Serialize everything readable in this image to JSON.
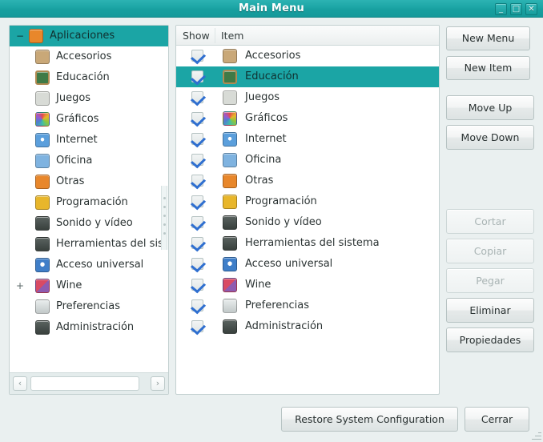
{
  "window": {
    "title": "Main Menu",
    "controls": {
      "minimize": {
        "name": "minimize-button",
        "glyph": "_"
      },
      "maximize": {
        "name": "maximize-button",
        "glyph": "□"
      },
      "close": {
        "name": "close-button",
        "glyph": "✕"
      }
    },
    "accent_color": "#1ba5a5",
    "titlebar_color": "#1ba4a4",
    "background_color": "#eaf0f0"
  },
  "tree": {
    "root": {
      "label": "Aplicaciones",
      "expander": "−",
      "selected": true,
      "icon": "applications-icon",
      "icon_color": "#e8872b"
    },
    "items": [
      {
        "label": "Accesorios",
        "icon": "accessories-icon",
        "icon_color": "#c9a878",
        "expander": ""
      },
      {
        "label": "Educación",
        "icon": "education-icon",
        "icon_color": "#3f7a46",
        "expander": ""
      },
      {
        "label": "Juegos",
        "icon": "games-icon",
        "icon_color": "#d8dbd6",
        "expander": ""
      },
      {
        "label": "Gráficos",
        "icon": "graphics-icon",
        "icon_color": "#c8d43a",
        "expander": ""
      },
      {
        "label": "Internet",
        "icon": "internet-icon",
        "icon_color": "#5b9fdc",
        "expander": ""
      },
      {
        "label": "Oficina",
        "icon": "office-icon",
        "icon_color": "#7fb3e0",
        "expander": ""
      },
      {
        "label": "Otras",
        "icon": "other-icon",
        "icon_color": "#e8872b",
        "expander": ""
      },
      {
        "label": "Programación",
        "icon": "programming-icon",
        "icon_color": "#e8b62b",
        "expander": ""
      },
      {
        "label": "Sonido y vídeo",
        "icon": "sound-video-icon",
        "icon_color": "#3a4a42",
        "expander": ""
      },
      {
        "label": "Herramientas del sist",
        "icon": "system-tools-icon",
        "icon_color": "#4a5350",
        "expander": ""
      },
      {
        "label": "Acceso universal",
        "icon": "universal-access-icon",
        "icon_color": "#3f7ec8",
        "expander": ""
      },
      {
        "label": "Wine",
        "icon": "wine-icon",
        "icon_color": "#c83a52",
        "expander": "+"
      },
      {
        "label": "Preferencias",
        "icon": "preferences-icon",
        "icon_color": "#c9cfcf",
        "expander": ""
      },
      {
        "label": "Administración",
        "icon": "administration-icon",
        "icon_color": "#4a5350",
        "expander": ""
      }
    ],
    "hscroll": {
      "left_arrow": "‹",
      "right_arrow": "›"
    }
  },
  "list": {
    "columns": [
      "Show",
      "Item"
    ],
    "rows": [
      {
        "label": "Accesorios",
        "checked": true,
        "selected": false,
        "icon": "accessories-icon",
        "icon_color": "#c9a878"
      },
      {
        "label": "Educación",
        "checked": true,
        "selected": true,
        "icon": "education-icon",
        "icon_color": "#3f7a46"
      },
      {
        "label": "Juegos",
        "checked": true,
        "selected": false,
        "icon": "games-icon",
        "icon_color": "#d8dbd6"
      },
      {
        "label": "Gráficos",
        "checked": true,
        "selected": false,
        "icon": "graphics-icon",
        "icon_color": "#c8d43a"
      },
      {
        "label": "Internet",
        "checked": true,
        "selected": false,
        "icon": "internet-icon",
        "icon_color": "#5b9fdc"
      },
      {
        "label": "Oficina",
        "checked": true,
        "selected": false,
        "icon": "office-icon",
        "icon_color": "#7fb3e0"
      },
      {
        "label": "Otras",
        "checked": true,
        "selected": false,
        "icon": "other-icon",
        "icon_color": "#e8872b"
      },
      {
        "label": "Programación",
        "checked": true,
        "selected": false,
        "icon": "programming-icon",
        "icon_color": "#e8b62b"
      },
      {
        "label": "Sonido y vídeo",
        "checked": true,
        "selected": false,
        "icon": "sound-video-icon",
        "icon_color": "#3a4a42"
      },
      {
        "label": "Herramientas del sistema",
        "checked": true,
        "selected": false,
        "icon": "system-tools-icon",
        "icon_color": "#4a5350"
      },
      {
        "label": "Acceso universal",
        "checked": true,
        "selected": false,
        "icon": "universal-access-icon",
        "icon_color": "#3f7ec8"
      },
      {
        "label": "Wine",
        "checked": true,
        "selected": false,
        "icon": "wine-icon",
        "icon_color": "#c83a52"
      },
      {
        "label": "Preferencias",
        "checked": true,
        "selected": false,
        "icon": "preferences-icon",
        "icon_color": "#c9cfcf"
      },
      {
        "label": "Administración",
        "checked": true,
        "selected": false,
        "icon": "administration-icon",
        "icon_color": "#4a5350"
      }
    ]
  },
  "side_buttons": [
    {
      "id": "new-menu",
      "label": "New Menu",
      "enabled": true
    },
    {
      "id": "new-item",
      "label": "New Item",
      "enabled": true
    },
    {
      "id": "move-up",
      "label": "Move Up",
      "enabled": true
    },
    {
      "id": "move-down",
      "label": "Move Down",
      "enabled": true
    },
    {
      "id": "cut",
      "label": "Cortar",
      "enabled": false
    },
    {
      "id": "copy",
      "label": "Copiar",
      "enabled": false
    },
    {
      "id": "paste",
      "label": "Pegar",
      "enabled": false
    },
    {
      "id": "delete",
      "label": "Eliminar",
      "enabled": true
    },
    {
      "id": "properties",
      "label": "Propiedades",
      "enabled": true
    }
  ],
  "bottom_buttons": [
    {
      "id": "restore-system-configuration",
      "label": "Restore System Configuration",
      "enabled": true
    },
    {
      "id": "close",
      "label": "Cerrar",
      "enabled": true
    }
  ]
}
